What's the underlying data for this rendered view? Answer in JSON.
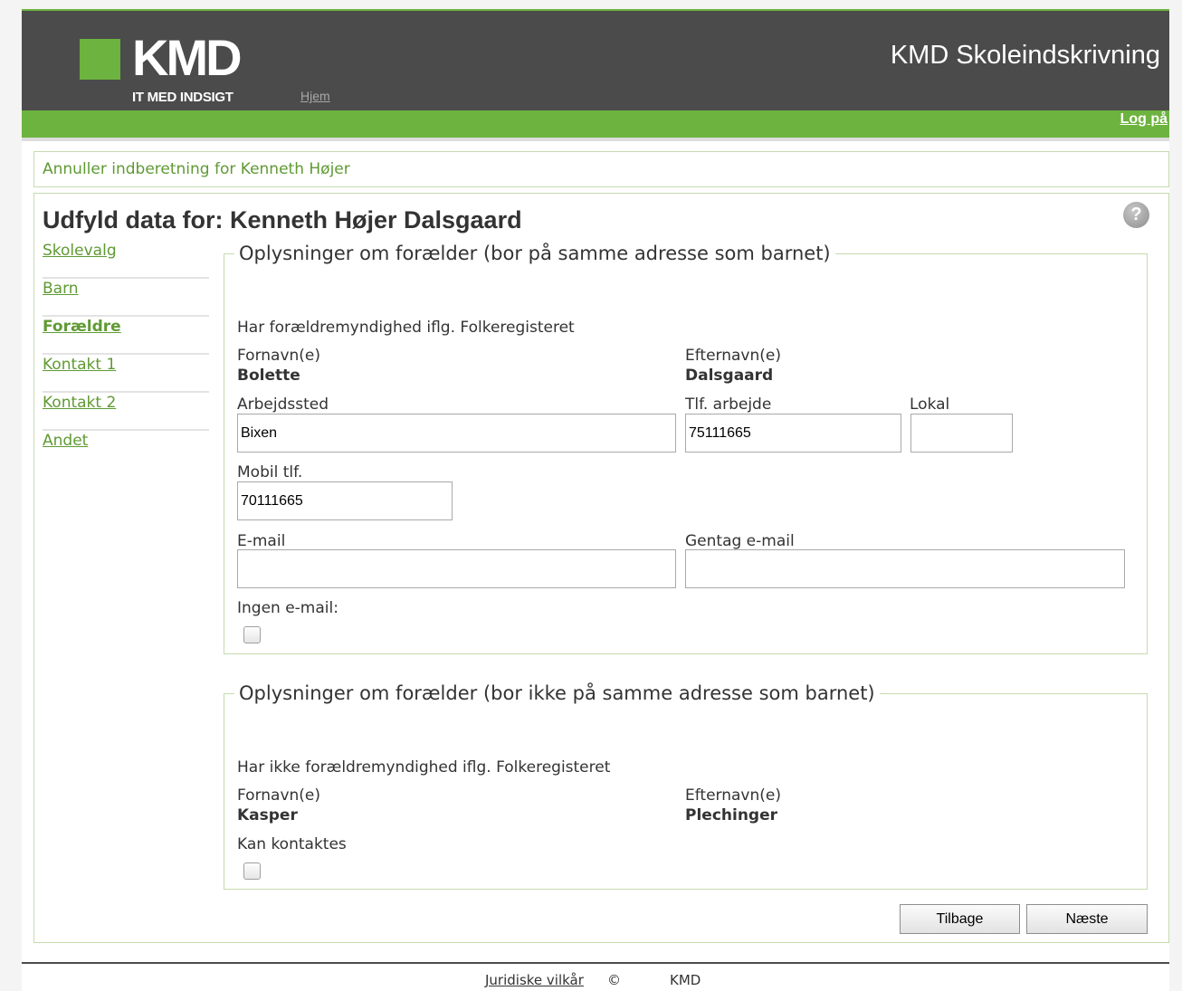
{
  "header": {
    "logo_text": "KMD",
    "tagline": "IT MED INDSIGT",
    "home_link": "Hjem",
    "app_title": "KMD Skoleindskrivning",
    "login_link": "Log på"
  },
  "cancel_link": "Annuller indberetning for Kenneth Højer",
  "page_title": "Udfyld data for: Kenneth Højer Dalsgaard",
  "help_icon_glyph": "?",
  "nav": {
    "items": [
      {
        "label": "Skolevalg"
      },
      {
        "label": "Barn"
      },
      {
        "label": "Forældre"
      },
      {
        "label": "Kontakt 1"
      },
      {
        "label": "Kontakt 2"
      },
      {
        "label": "Andet"
      }
    ]
  },
  "parent1": {
    "legend": "Oplysninger om forælder (bor på samme adresse som barnet)",
    "custody_text": "Har forældremyndighed iflg. Folkeregisteret",
    "firstname_label": "Fornavn(e)",
    "firstname_value": "Bolette",
    "lastname_label": "Efternavn(e)",
    "lastname_value": "Dalsgaard",
    "workplace_label": "Arbejdssted",
    "workplace_value": "Bixen",
    "workphone_label": "Tlf. arbejde",
    "workphone_value": "75111665",
    "local_label": "Lokal",
    "local_value": "",
    "mobile_label": "Mobil tlf.",
    "mobile_value": "70111665",
    "email_label": "E-mail",
    "email_value": "",
    "email_repeat_label": "Gentag e-mail",
    "email_repeat_value": "",
    "no_email_label": "Ingen e-mail:"
  },
  "parent2": {
    "legend": "Oplysninger om forælder (bor ikke på samme adresse som barnet)",
    "custody_text": "Har ikke forældremyndighed iflg. Folkeregisteret",
    "firstname_label": "Fornavn(e)",
    "firstname_value": "Kasper",
    "lastname_label": "Efternavn(e)",
    "lastname_value": "Plechinger",
    "contact_label": "Kan kontaktes"
  },
  "buttons": {
    "back": "Tilbage",
    "next": "Næste"
  },
  "footer": {
    "legal_link": "Juridiske vilkår",
    "copyright": "©",
    "company": "KMD"
  },
  "colors": {
    "brand_green": "#6db33f",
    "header_gray": "#4b4b4b",
    "link_green": "#5f9a33"
  }
}
